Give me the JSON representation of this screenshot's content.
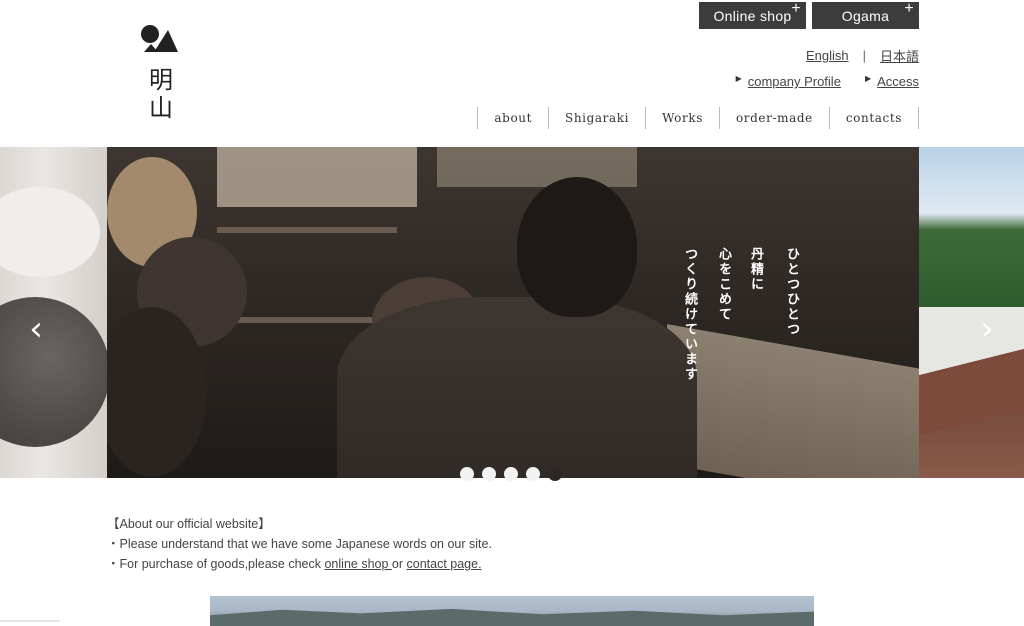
{
  "header": {
    "logo_text": "明山",
    "top_buttons": [
      {
        "label": "Online shop"
      },
      {
        "label": "Ogama"
      }
    ],
    "plus_glyph": "+",
    "lang": {
      "english": "English",
      "separator": "|",
      "japanese": "日本語"
    },
    "sublinks": [
      {
        "label": "company Profile"
      },
      {
        "label": "Access"
      }
    ],
    "nav": [
      "about",
      "Shigaraki",
      "Works",
      "order-made",
      "contacts"
    ]
  },
  "slider": {
    "caption_lines": [
      "ひとつひとつ",
      "丹精に",
      "心をこめて",
      "つくり続けています"
    ],
    "prev_glyph": "‹",
    "next_glyph": "›",
    "dot_count": 5,
    "active_dot": 4
  },
  "notice": {
    "heading": "【About our official website】",
    "line1": "・Please understand that we have some Japanese words on our site.",
    "line2_prefix": "・For purchase of goods,please check ",
    "online_shop_link": "online shop ",
    "or_text": "or ",
    "contact_link": "contact page."
  },
  "colors": {
    "button_bg": "#3c3c3c",
    "dot_active": "#2c2825",
    "dot_inactive": "#f2f2f2"
  }
}
